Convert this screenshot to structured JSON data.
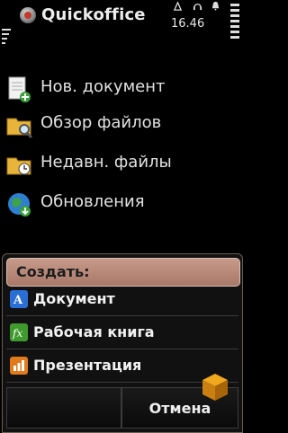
{
  "app": {
    "title": "Quickoffice"
  },
  "status": {
    "time": "16.46",
    "signal_label": "1⊿ "
  },
  "menu": {
    "items": [
      {
        "label": "Нов. документ",
        "icon": "new-document-icon"
      },
      {
        "label": "Обзор файлов",
        "icon": "browse-folder-icon"
      },
      {
        "label": "Недавн. файлы",
        "icon": "recent-files-folder-icon"
      },
      {
        "label": "Обновления",
        "icon": "updates-globe-icon"
      }
    ]
  },
  "dialog": {
    "title": "Создать:",
    "options": [
      {
        "label": "Документ",
        "icon": "word-document-icon",
        "color": "#2a6fd6"
      },
      {
        "label": "Рабочая книга",
        "icon": "spreadsheet-icon",
        "color": "#3f9a2d"
      },
      {
        "label": "Презентация",
        "icon": "presentation-icon",
        "color": "#e07a1c"
      }
    ],
    "softkeys": {
      "left": "",
      "right": "Отмена"
    }
  },
  "colors": {
    "header": "#b8887a",
    "background": "#000000"
  }
}
